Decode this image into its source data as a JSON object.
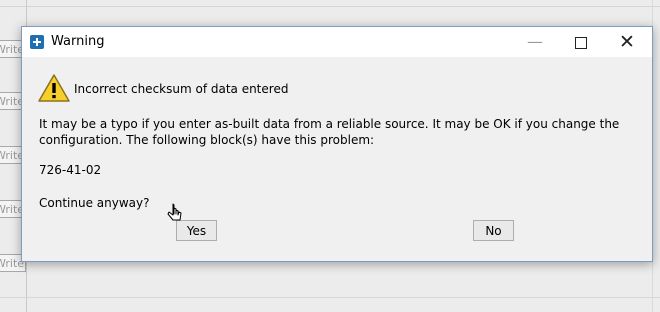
{
  "background_app": {
    "buttons": [
      "Write",
      "Write",
      "Write",
      "Write",
      "Write"
    ]
  },
  "dialog": {
    "title": "Warning",
    "controls": {
      "minimize": "—",
      "close": "✕"
    },
    "heading": "Incorrect checksum of data entered",
    "message": "It may be a typo if you enter as-built data from a reliable source. It may be OK if you change the configuration. The following block(s) have this problem:",
    "blocks": "726-41-02",
    "question": "Continue anyway?",
    "buttons": {
      "yes": "Yes",
      "no": "No"
    },
    "icon": "warning-icon"
  }
}
